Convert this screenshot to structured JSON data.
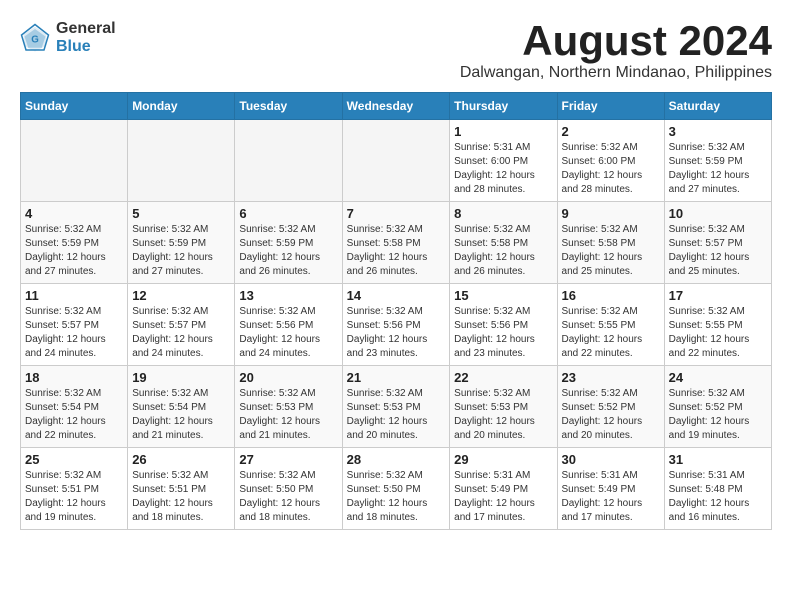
{
  "header": {
    "logo_general": "General",
    "logo_blue": "Blue",
    "month_title": "August 2024",
    "location": "Dalwangan, Northern Mindanao, Philippines"
  },
  "weekdays": [
    "Sunday",
    "Monday",
    "Tuesday",
    "Wednesday",
    "Thursday",
    "Friday",
    "Saturday"
  ],
  "weeks": [
    [
      {
        "day": "",
        "info": ""
      },
      {
        "day": "",
        "info": ""
      },
      {
        "day": "",
        "info": ""
      },
      {
        "day": "",
        "info": ""
      },
      {
        "day": "1",
        "info": "Sunrise: 5:31 AM\nSunset: 6:00 PM\nDaylight: 12 hours\nand 28 minutes."
      },
      {
        "day": "2",
        "info": "Sunrise: 5:32 AM\nSunset: 6:00 PM\nDaylight: 12 hours\nand 28 minutes."
      },
      {
        "day": "3",
        "info": "Sunrise: 5:32 AM\nSunset: 5:59 PM\nDaylight: 12 hours\nand 27 minutes."
      }
    ],
    [
      {
        "day": "4",
        "info": "Sunrise: 5:32 AM\nSunset: 5:59 PM\nDaylight: 12 hours\nand 27 minutes."
      },
      {
        "day": "5",
        "info": "Sunrise: 5:32 AM\nSunset: 5:59 PM\nDaylight: 12 hours\nand 27 minutes."
      },
      {
        "day": "6",
        "info": "Sunrise: 5:32 AM\nSunset: 5:59 PM\nDaylight: 12 hours\nand 26 minutes."
      },
      {
        "day": "7",
        "info": "Sunrise: 5:32 AM\nSunset: 5:58 PM\nDaylight: 12 hours\nand 26 minutes."
      },
      {
        "day": "8",
        "info": "Sunrise: 5:32 AM\nSunset: 5:58 PM\nDaylight: 12 hours\nand 26 minutes."
      },
      {
        "day": "9",
        "info": "Sunrise: 5:32 AM\nSunset: 5:58 PM\nDaylight: 12 hours\nand 25 minutes."
      },
      {
        "day": "10",
        "info": "Sunrise: 5:32 AM\nSunset: 5:57 PM\nDaylight: 12 hours\nand 25 minutes."
      }
    ],
    [
      {
        "day": "11",
        "info": "Sunrise: 5:32 AM\nSunset: 5:57 PM\nDaylight: 12 hours\nand 24 minutes."
      },
      {
        "day": "12",
        "info": "Sunrise: 5:32 AM\nSunset: 5:57 PM\nDaylight: 12 hours\nand 24 minutes."
      },
      {
        "day": "13",
        "info": "Sunrise: 5:32 AM\nSunset: 5:56 PM\nDaylight: 12 hours\nand 24 minutes."
      },
      {
        "day": "14",
        "info": "Sunrise: 5:32 AM\nSunset: 5:56 PM\nDaylight: 12 hours\nand 23 minutes."
      },
      {
        "day": "15",
        "info": "Sunrise: 5:32 AM\nSunset: 5:56 PM\nDaylight: 12 hours\nand 23 minutes."
      },
      {
        "day": "16",
        "info": "Sunrise: 5:32 AM\nSunset: 5:55 PM\nDaylight: 12 hours\nand 22 minutes."
      },
      {
        "day": "17",
        "info": "Sunrise: 5:32 AM\nSunset: 5:55 PM\nDaylight: 12 hours\nand 22 minutes."
      }
    ],
    [
      {
        "day": "18",
        "info": "Sunrise: 5:32 AM\nSunset: 5:54 PM\nDaylight: 12 hours\nand 22 minutes."
      },
      {
        "day": "19",
        "info": "Sunrise: 5:32 AM\nSunset: 5:54 PM\nDaylight: 12 hours\nand 21 minutes."
      },
      {
        "day": "20",
        "info": "Sunrise: 5:32 AM\nSunset: 5:53 PM\nDaylight: 12 hours\nand 21 minutes."
      },
      {
        "day": "21",
        "info": "Sunrise: 5:32 AM\nSunset: 5:53 PM\nDaylight: 12 hours\nand 20 minutes."
      },
      {
        "day": "22",
        "info": "Sunrise: 5:32 AM\nSunset: 5:53 PM\nDaylight: 12 hours\nand 20 minutes."
      },
      {
        "day": "23",
        "info": "Sunrise: 5:32 AM\nSunset: 5:52 PM\nDaylight: 12 hours\nand 20 minutes."
      },
      {
        "day": "24",
        "info": "Sunrise: 5:32 AM\nSunset: 5:52 PM\nDaylight: 12 hours\nand 19 minutes."
      }
    ],
    [
      {
        "day": "25",
        "info": "Sunrise: 5:32 AM\nSunset: 5:51 PM\nDaylight: 12 hours\nand 19 minutes."
      },
      {
        "day": "26",
        "info": "Sunrise: 5:32 AM\nSunset: 5:51 PM\nDaylight: 12 hours\nand 18 minutes."
      },
      {
        "day": "27",
        "info": "Sunrise: 5:32 AM\nSunset: 5:50 PM\nDaylight: 12 hours\nand 18 minutes."
      },
      {
        "day": "28",
        "info": "Sunrise: 5:32 AM\nSunset: 5:50 PM\nDaylight: 12 hours\nand 18 minutes."
      },
      {
        "day": "29",
        "info": "Sunrise: 5:31 AM\nSunset: 5:49 PM\nDaylight: 12 hours\nand 17 minutes."
      },
      {
        "day": "30",
        "info": "Sunrise: 5:31 AM\nSunset: 5:49 PM\nDaylight: 12 hours\nand 17 minutes."
      },
      {
        "day": "31",
        "info": "Sunrise: 5:31 AM\nSunset: 5:48 PM\nDaylight: 12 hours\nand 16 minutes."
      }
    ]
  ]
}
